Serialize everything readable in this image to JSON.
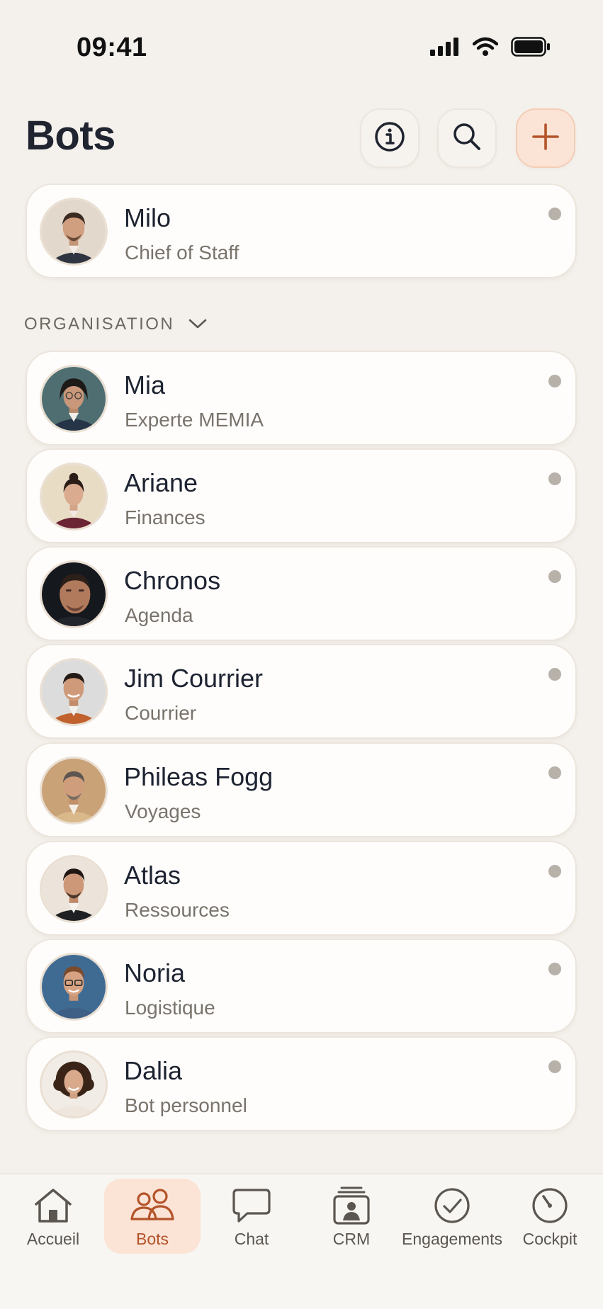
{
  "status_bar": {
    "time": "09:41"
  },
  "header": {
    "title": "Bots",
    "info_icon": "info-icon",
    "search_icon": "search-icon",
    "add_icon": "plus-icon"
  },
  "featured": {
    "name": "Milo",
    "role": "Chief of Staff"
  },
  "section": {
    "label": "ORGANISATION"
  },
  "bots": [
    {
      "name": "Mia",
      "role": "Experte MEMIA"
    },
    {
      "name": "Ariane",
      "role": "Finances"
    },
    {
      "name": "Chronos",
      "role": "Agenda"
    },
    {
      "name": "Jim Courrier",
      "role": "Courrier"
    },
    {
      "name": "Phileas Fogg",
      "role": "Voyages"
    },
    {
      "name": "Atlas",
      "role": "Ressources"
    },
    {
      "name": "Noria",
      "role": "Logistique"
    },
    {
      "name": "Dalia",
      "role": "Bot personnel"
    }
  ],
  "nav": {
    "items": [
      {
        "label": "Accueil",
        "icon": "home-icon"
      },
      {
        "label": "Bots",
        "icon": "users-icon",
        "active": true
      },
      {
        "label": "Chat",
        "icon": "chat-icon"
      },
      {
        "label": "CRM",
        "icon": "contact-card-icon"
      },
      {
        "label": "Engagements",
        "icon": "check-circle-icon"
      },
      {
        "label": "Cockpit",
        "icon": "gauge-icon"
      }
    ]
  },
  "colors": {
    "background": "#f4f1ec",
    "accent": "#b4532a",
    "accent_soft": "#fbe4d6",
    "card": "#fefdfb",
    "status_dot": "#b7b1aa"
  }
}
